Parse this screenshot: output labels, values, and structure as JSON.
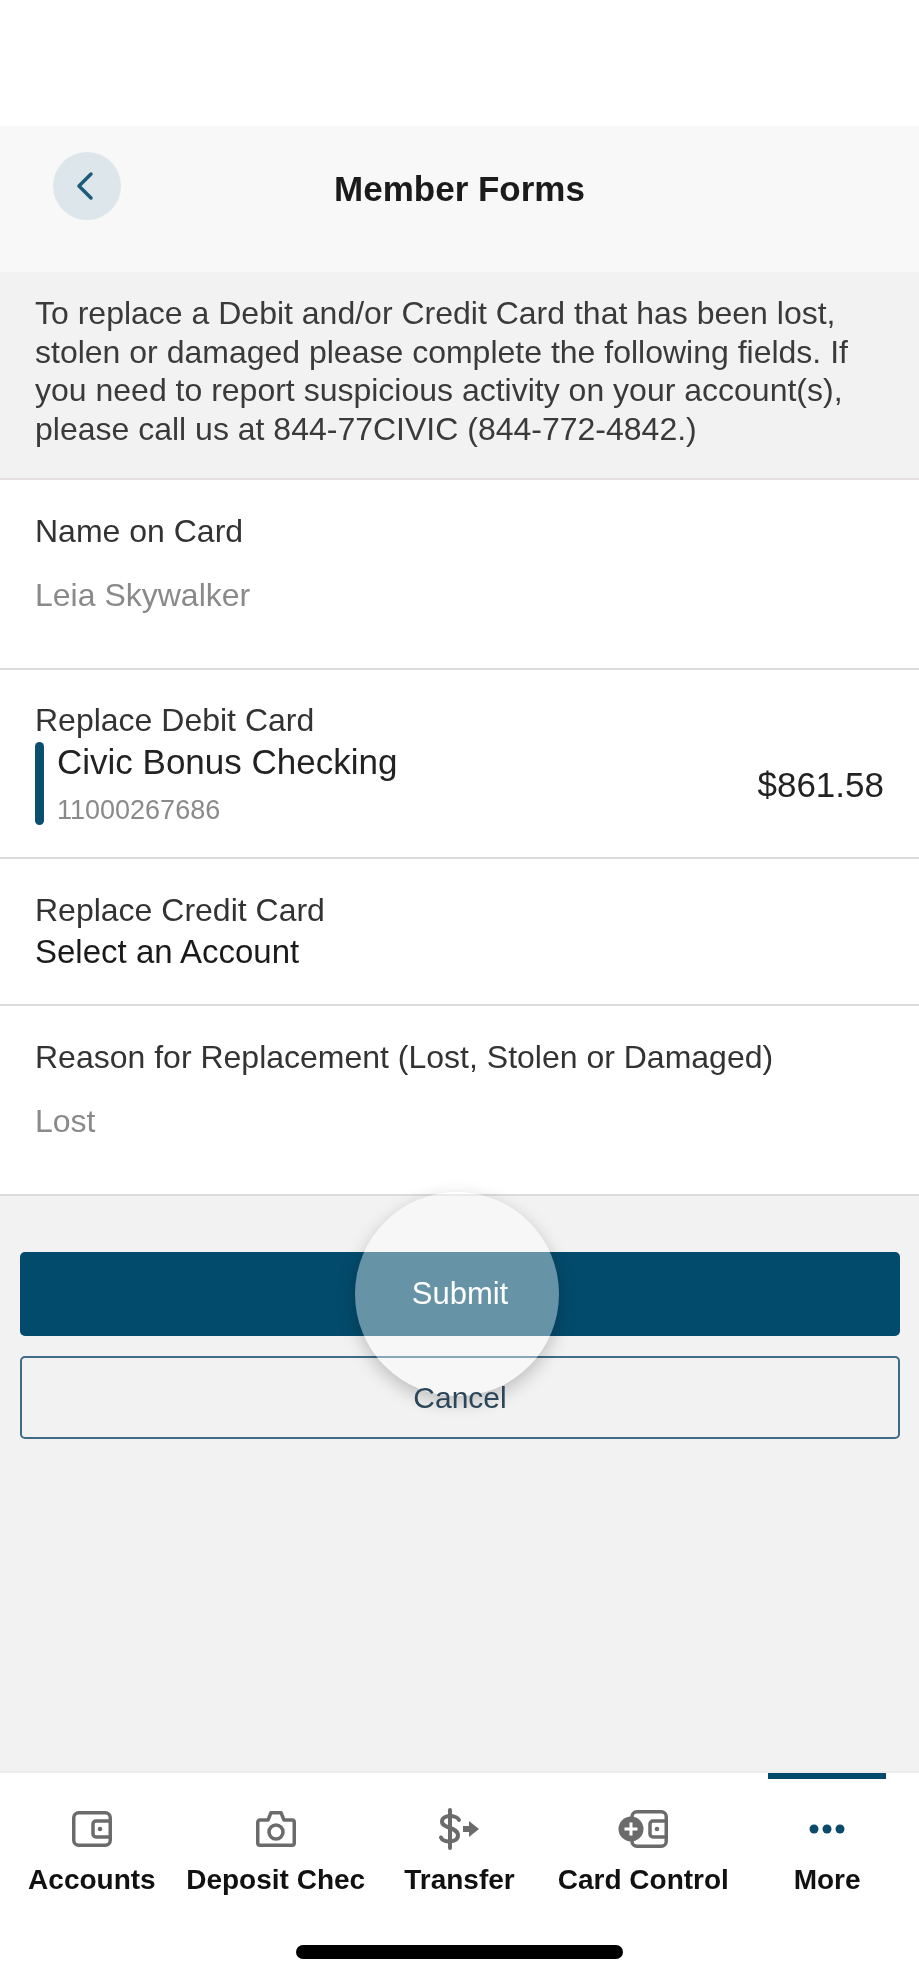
{
  "header": {
    "title": "Member Forms"
  },
  "notice": "To replace a Debit and/or Credit Card that has been lost, stolen or damaged please complete the following fields. If you need to report suspicious activity on your account(s), please call us at 844-77CIVIC (844-772-4842.)",
  "fields": [
    {
      "kind": "text",
      "label": "Name on Card",
      "value": "Leia Skywalker"
    },
    {
      "kind": "account",
      "label": "Replace Debit Card",
      "account_name": "Civic Bonus Checking",
      "account_number": "11000267686",
      "balance": "$861.58"
    },
    {
      "kind": "select",
      "label": "Replace Credit Card",
      "value": "Select an Account"
    },
    {
      "kind": "text",
      "label": "Reason for Replacement (Lost, Stolen or Damaged)",
      "value": "Lost"
    }
  ],
  "buttons": [
    {
      "kind": "primary",
      "label": "Submit"
    },
    {
      "kind": "secondary",
      "label": "Cancel"
    }
  ],
  "tab_bar": [
    {
      "label": "Accounts",
      "selected": false
    },
    {
      "label": "Deposit Chec",
      "selected": false
    },
    {
      "label": "Transfer",
      "selected": false
    },
    {
      "label": "Card Control",
      "selected": false
    },
    {
      "label": "More",
      "selected": true
    }
  ]
}
